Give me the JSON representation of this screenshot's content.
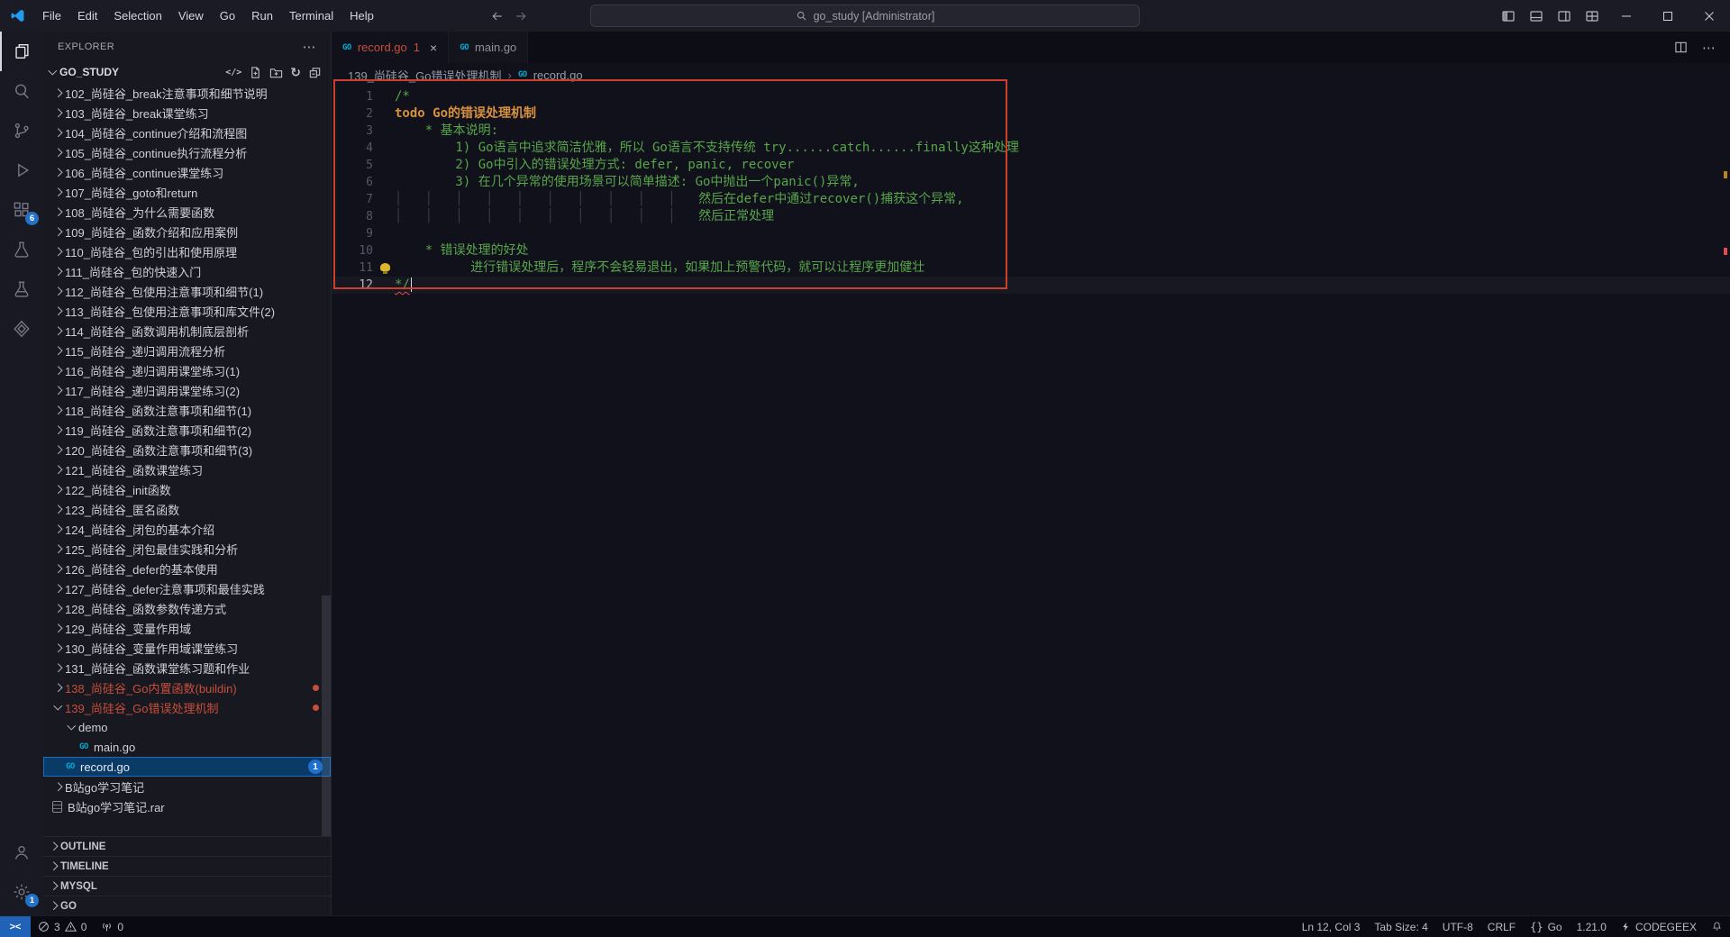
{
  "title_bar": {
    "menus": [
      "File",
      "Edit",
      "Selection",
      "View",
      "Go",
      "Run",
      "Terminal",
      "Help"
    ],
    "search_text": "go_study [Administrator]"
  },
  "icons": {
    "more": "⋯",
    "refresh": "↻",
    "code": "</>",
    "remote": "><",
    "close": "×",
    "crumb_sep": "›",
    "go_file": "GO"
  },
  "activity_bar": {
    "extensions_badge": "6",
    "settings_badge": "1"
  },
  "sidebar": {
    "title": "EXPLORER",
    "section": "GO_STUDY",
    "tree": [
      {
        "label": "102_尚硅谷_break注意事项和细节说明",
        "type": "folder",
        "level": 1
      },
      {
        "label": "103_尚硅谷_break课堂练习",
        "type": "folder",
        "level": 1
      },
      {
        "label": "104_尚硅谷_continue介绍和流程图",
        "type": "folder",
        "level": 1
      },
      {
        "label": "105_尚硅谷_continue执行流程分析",
        "type": "folder",
        "level": 1
      },
      {
        "label": "106_尚硅谷_continue课堂练习",
        "type": "folder",
        "level": 1
      },
      {
        "label": "107_尚硅谷_goto和return",
        "type": "folder",
        "level": 1
      },
      {
        "label": "108_尚硅谷_为什么需要函数",
        "type": "folder",
        "level": 1
      },
      {
        "label": "109_尚硅谷_函数介绍和应用案例",
        "type": "folder",
        "level": 1
      },
      {
        "label": "110_尚硅谷_包的引出和使用原理",
        "type": "folder",
        "level": 1
      },
      {
        "label": "111_尚硅谷_包的快速入门",
        "type": "folder",
        "level": 1
      },
      {
        "label": "112_尚硅谷_包使用注意事项和细节(1)",
        "type": "folder",
        "level": 1
      },
      {
        "label": "113_尚硅谷_包使用注意事项和库文件(2)",
        "type": "folder",
        "level": 1
      },
      {
        "label": "114_尚硅谷_函数调用机制底层剖析",
        "type": "folder",
        "level": 1
      },
      {
        "label": "115_尚硅谷_递归调用流程分析",
        "type": "folder",
        "level": 1
      },
      {
        "label": "116_尚硅谷_递归调用课堂练习(1)",
        "type": "folder",
        "level": 1
      },
      {
        "label": "117_尚硅谷_递归调用课堂练习(2)",
        "type": "folder",
        "level": 1
      },
      {
        "label": "118_尚硅谷_函数注意事项和细节(1)",
        "type": "folder",
        "level": 1
      },
      {
        "label": "119_尚硅谷_函数注意事项和细节(2)",
        "type": "folder",
        "level": 1
      },
      {
        "label": "120_尚硅谷_函数注意事项和细节(3)",
        "type": "folder",
        "level": 1
      },
      {
        "label": "121_尚硅谷_函数课堂练习",
        "type": "folder",
        "level": 1
      },
      {
        "label": "122_尚硅谷_init函数",
        "type": "folder",
        "level": 1
      },
      {
        "label": "123_尚硅谷_匿名函数",
        "type": "folder",
        "level": 1
      },
      {
        "label": "124_尚硅谷_闭包的基本介绍",
        "type": "folder",
        "level": 1
      },
      {
        "label": "125_尚硅谷_闭包最佳实践和分析",
        "type": "folder",
        "level": 1
      },
      {
        "label": "126_尚硅谷_defer的基本使用",
        "type": "folder",
        "level": 1
      },
      {
        "label": "127_尚硅谷_defer注意事项和最佳实践",
        "type": "folder",
        "level": 1
      },
      {
        "label": "128_尚硅谷_函数参数传递方式",
        "type": "folder",
        "level": 1
      },
      {
        "label": "129_尚硅谷_变量作用域",
        "type": "folder",
        "level": 1
      },
      {
        "label": "130_尚硅谷_变量作用域课堂练习",
        "type": "folder",
        "level": 1
      },
      {
        "label": "131_尚硅谷_函数课堂练习题和作业",
        "type": "folder",
        "level": 1
      },
      {
        "label": "138_尚硅谷_Go内置函数(buildin)",
        "type": "folder",
        "level": 1,
        "decorated": true,
        "dot": true
      },
      {
        "label": "139_尚硅谷_Go错误处理机制",
        "type": "folder",
        "level": 1,
        "expanded": true,
        "decorated": true,
        "dot": true
      },
      {
        "label": "demo",
        "type": "folder",
        "level": 2,
        "expanded": true
      },
      {
        "label": "main.go",
        "type": "file",
        "icon": "go",
        "level": 3
      },
      {
        "label": "record.go",
        "type": "file",
        "icon": "go",
        "level": 2,
        "selected": true,
        "badge": "1"
      },
      {
        "label": "B站go学习笔记",
        "type": "folder",
        "level": 1
      },
      {
        "label": "B站go学习笔记.rar",
        "type": "file",
        "icon": "rar",
        "level": 1
      }
    ],
    "panels": [
      "OUTLINE",
      "TIMELINE",
      "MYSQL",
      "GO"
    ]
  },
  "tabs": [
    {
      "label": "record.go",
      "badge": "1",
      "active": true,
      "icon": "go"
    },
    {
      "label": "main.go",
      "active": false,
      "icon": "go"
    }
  ],
  "editor": {
    "breadcrumb_folder": "139_尚硅谷_Go错误处理机制",
    "breadcrumb_file": "record.go"
  },
  "code": {
    "lines": [
      {
        "n": "1",
        "segs": [
          {
            "t": "/*",
            "c": "comment"
          }
        ]
      },
      {
        "n": "2",
        "segs": [
          {
            "t": "todo Go的错误处理机制",
            "c": "todo"
          }
        ]
      },
      {
        "n": "3",
        "segs": [
          {
            "t": "    * 基本说明:",
            "c": "comment"
          }
        ]
      },
      {
        "n": "4",
        "segs": [
          {
            "t": "        1) Go语言中追求简洁优雅，所以 Go语言不支持传统 try......catch......finally这种处理",
            "c": "comment"
          }
        ]
      },
      {
        "n": "5",
        "segs": [
          {
            "t": "        2) Go中引入的错误处理方式: defer, panic, recover",
            "c": "comment"
          }
        ]
      },
      {
        "n": "6",
        "segs": [
          {
            "t": "        3) 在几个异常的使用场景可以简单描述: Go中抛出一个panic()异常,",
            "c": "comment"
          }
        ]
      },
      {
        "n": "7",
        "segs": [
          {
            "t": "│   │   │   │   │   │   │   │   │   │   ",
            "c": "guide"
          },
          {
            "t": "然后在defer中通过recover()捕获这个异常,",
            "c": "comment"
          }
        ]
      },
      {
        "n": "8",
        "segs": [
          {
            "t": "│   │   │   │   │   │   │   │   │   │   ",
            "c": "guide"
          },
          {
            "t": "然后正常处理",
            "c": "comment"
          }
        ]
      },
      {
        "n": "9",
        "segs": []
      },
      {
        "n": "10",
        "segs": [
          {
            "t": "    * 错误处理的好处",
            "c": "comment"
          }
        ]
      },
      {
        "n": "11",
        "bulb": true,
        "segs": [
          {
            "t": "          进行错误处理后，程序不会轻易退出，如果加上预警代码，就可以让程序更加健壮",
            "c": "comment"
          }
        ]
      },
      {
        "n": "12",
        "active": true,
        "cursor": true,
        "segs": [
          {
            "t": "*/",
            "c": "comment err"
          }
        ]
      }
    ]
  },
  "status_bar": {
    "errors": "3",
    "warnings": "0",
    "ports": "0",
    "cursor": "Ln 12, Col 3",
    "tab_size": "Tab Size: 4",
    "encoding": "UTF-8",
    "eol": "CRLF",
    "braces": "{}",
    "language": "Go",
    "go_version": "1.21.0",
    "assistant": "CODEGEEX"
  }
}
